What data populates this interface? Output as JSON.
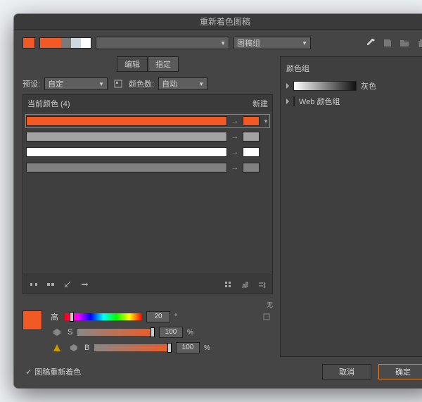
{
  "title": "重新着色图稿",
  "top": {
    "group_select_value": "图稿组",
    "swatch_color": "#f15a24",
    "seg": [
      "#7a7a7a",
      "#cfd6dc",
      "#ffffff"
    ]
  },
  "tabs": {
    "edit": "编辑",
    "assign": "指定",
    "active": 1
  },
  "preset": {
    "label": "预设:",
    "value": "自定"
  },
  "colornum": {
    "label": "颜色数:",
    "value": "自动"
  },
  "panel": {
    "current_label": "当前颜色 (4)",
    "new_label": "新建",
    "rows": [
      {
        "from": "#f15a24",
        "to": "#f15a24",
        "selected": true
      },
      {
        "from": "#a3a3a3",
        "to": "#a3a3a3",
        "selected": false
      },
      {
        "from": "#ffffff",
        "to": "#ffffff",
        "selected": false
      },
      {
        "from": "#808080",
        "to": "#808080",
        "selected": false
      }
    ]
  },
  "none_label": "无",
  "sliders": {
    "h_label": "高",
    "h_value": "20",
    "s_label": "S",
    "s_value": "100",
    "b_label": "B",
    "b_value": "100"
  },
  "groups": {
    "header": "颜色组",
    "items": [
      {
        "label": "灰色",
        "type": "gray"
      },
      {
        "label": "Web 颜色组",
        "type": "web"
      }
    ]
  },
  "web_colors": [
    "#ff0000",
    "#f06",
    "#f0f",
    "#909",
    "#06f",
    "#0cf",
    "#0c6",
    "#6c0",
    "#cc0",
    "#f90"
  ],
  "checkbox_label": "图稿重新着色",
  "buttons": {
    "cancel": "取消",
    "ok": "确定"
  }
}
